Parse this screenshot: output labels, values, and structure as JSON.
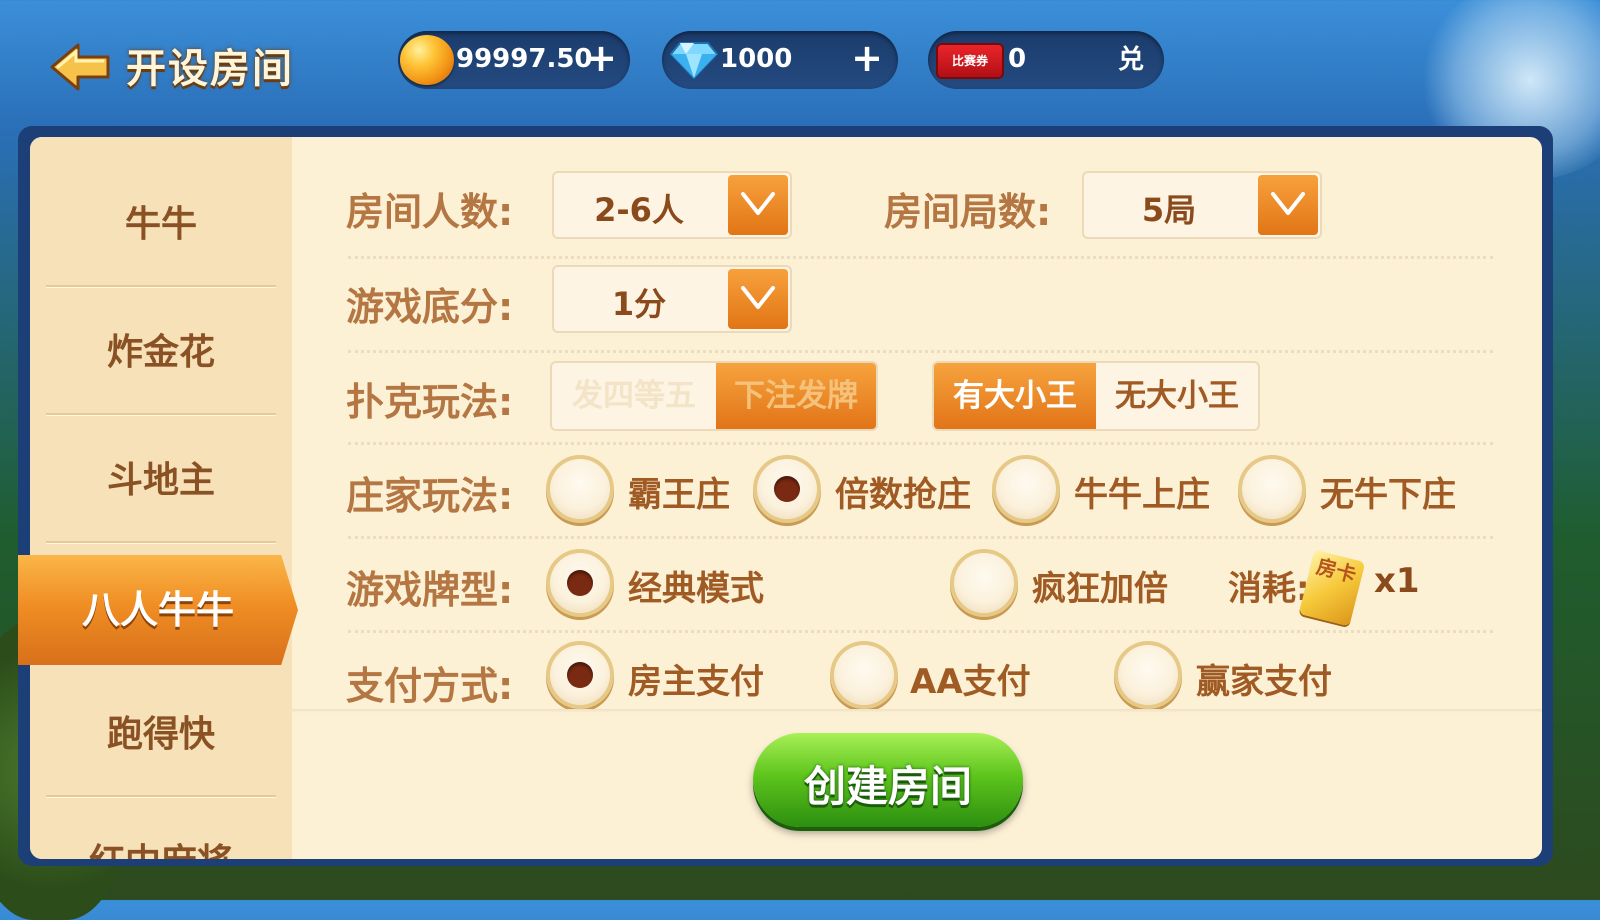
{
  "header": {
    "title": "开设房间"
  },
  "resources": {
    "gold": {
      "value": "99997.50",
      "add_label": "+"
    },
    "diamond": {
      "value": "1000",
      "add_label": "+"
    },
    "ticket": {
      "icon_label": "比赛券",
      "value": "0",
      "exchange_label": "兑"
    }
  },
  "sidebar": {
    "items": [
      {
        "label": "牛牛"
      },
      {
        "label": "炸金花"
      },
      {
        "label": "斗地主"
      },
      {
        "label": "八人牛牛",
        "active": true
      },
      {
        "label": "跑得快"
      },
      {
        "label": "红中麻将"
      }
    ]
  },
  "settings": {
    "players": {
      "label": "房间人数:",
      "value": "2-6人"
    },
    "rounds": {
      "label": "房间局数:",
      "value": "5局"
    },
    "base_score": {
      "label": "游戏底分:",
      "value": "1分"
    },
    "poker_play": {
      "label": "扑克玩法:",
      "deal_options": [
        "发四等五",
        "下注发牌"
      ],
      "deal_selected": 1,
      "joker_options": [
        "有大小王",
        "无大小王"
      ],
      "joker_selected": 0
    },
    "banker_play": {
      "label": "庄家玩法:",
      "options": [
        "霸王庄",
        "倍数抢庄",
        "牛牛上庄",
        "无牛下庄"
      ],
      "selected": 1
    },
    "card_type": {
      "label": "游戏牌型:",
      "options": [
        "经典模式",
        "疯狂加倍"
      ],
      "selected": 0,
      "cost_label": "消耗:",
      "cost_card_text": "房卡",
      "cost_value": "x1"
    },
    "payment": {
      "label": "支付方式:",
      "options": [
        "房主支付",
        "AA支付",
        "赢家支付"
      ],
      "selected": 0
    }
  },
  "create_button": {
    "label": "创建房间"
  },
  "colors": {
    "accent_orange": "#e9801c",
    "label_brown": "#b47642",
    "create_green": "#4fb81a"
  }
}
